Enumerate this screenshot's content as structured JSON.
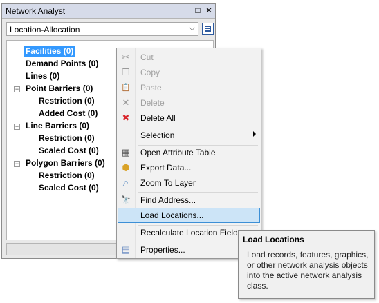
{
  "window": {
    "title": "Network Analyst",
    "restore_glyph": "□",
    "close_glyph": "✕",
    "selected_layer": "Location-Allocation"
  },
  "tree": [
    {
      "label": "Facilities (0)"
    },
    {
      "label": "Demand Points (0)"
    },
    {
      "label": "Lines (0)"
    },
    {
      "label": "Point Barriers (0)"
    },
    {
      "label": "Restriction (0)"
    },
    {
      "label": "Added Cost (0)"
    },
    {
      "label": "Line Barriers (0)"
    },
    {
      "label": "Restriction (0)"
    },
    {
      "label": "Scaled Cost (0)"
    },
    {
      "label": "Polygon Barriers (0)"
    },
    {
      "label": "Restriction (0)"
    },
    {
      "label": "Scaled Cost (0)"
    }
  ],
  "expander_glyph": "−",
  "menu": [
    {
      "label": "Cut",
      "icon": "cut-icon",
      "glyph": "✂",
      "enabled": false
    },
    {
      "label": "Copy",
      "icon": "copy-icon",
      "glyph": "❐",
      "enabled": false
    },
    {
      "label": "Paste",
      "icon": "paste-icon",
      "glyph": "📋",
      "enabled": false
    },
    {
      "label": "Delete",
      "icon": "delete-icon",
      "glyph": "✕",
      "enabled": false
    },
    {
      "label": "Delete All",
      "icon": "delete-all-icon",
      "glyph": "✖",
      "enabled": true
    },
    {
      "label": "Selection",
      "icon": "",
      "glyph": "",
      "enabled": true
    },
    {
      "label": "Open Attribute Table",
      "icon": "table-icon",
      "glyph": "▦",
      "enabled": true
    },
    {
      "label": "Export Data...",
      "icon": "export-icon",
      "glyph": "⬢",
      "enabled": true
    },
    {
      "label": "Zoom To Layer",
      "icon": "zoom-icon",
      "glyph": "⌕",
      "enabled": true
    },
    {
      "label": "Find Address...",
      "icon": "binoculars-icon",
      "glyph": "🔭",
      "enabled": true
    },
    {
      "label": "Load Locations...",
      "icon": "",
      "glyph": "",
      "enabled": true
    },
    {
      "label": "Recalculate Location Fields",
      "icon": "",
      "glyph": "",
      "enabled": true
    },
    {
      "label": "Properties...",
      "icon": "properties-icon",
      "glyph": "▤",
      "enabled": true
    }
  ],
  "tooltip": {
    "title": "Load Locations",
    "body": "Load records, features, graphics, or other network analysis objects into the active network analysis class."
  },
  "colors": {
    "selection_blue": "#3399ff",
    "hover_blue": "#cce4f7",
    "delete_red": "#d9262c",
    "title_bar": "#d6dbe9"
  }
}
